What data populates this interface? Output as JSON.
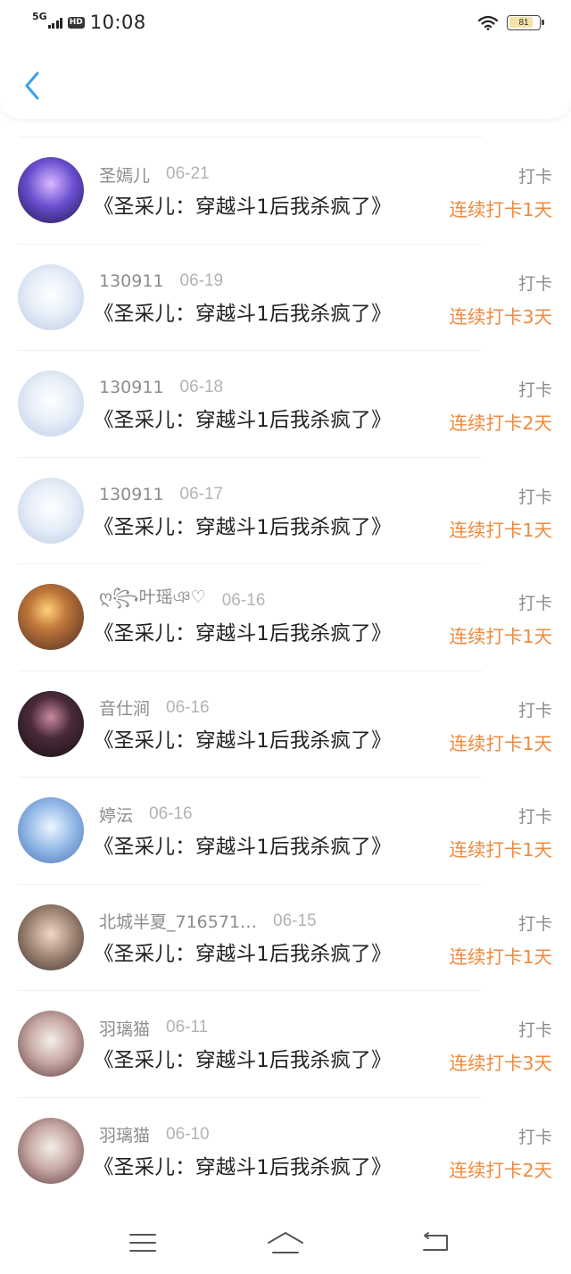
{
  "status_bar": {
    "network": "5G",
    "hd_badge": "HD",
    "time": "10:08",
    "battery_level": "81",
    "battery_fraction": 0.81
  },
  "header": {
    "back_icon": "chevron-left-icon",
    "accent_color": "#3aa0e8"
  },
  "colors": {
    "streak_orange": "#f08a3c",
    "name_gray": "#8c8c8c",
    "date_gray": "#b3b3b3"
  },
  "records": [
    {
      "name": "圣嫣儿",
      "date": "06-21",
      "book": "《圣采儿：穿越斗1后我杀疯了》",
      "type": "打卡",
      "streak": "连续打卡1天"
    },
    {
      "name": "130911",
      "date": "06-19",
      "book": "《圣采儿：穿越斗1后我杀疯了》",
      "type": "打卡",
      "streak": "连续打卡3天"
    },
    {
      "name": "130911",
      "date": "06-18",
      "book": "《圣采儿：穿越斗1后我杀疯了》",
      "type": "打卡",
      "streak": "连续打卡2天"
    },
    {
      "name": "130911",
      "date": "06-17",
      "book": "《圣采儿：穿越斗1后我杀疯了》",
      "type": "打卡",
      "streak": "连续打卡1天"
    },
    {
      "name": "ღ꧂叶瑶ঞ♡",
      "date": "06-16",
      "book": "《圣采儿：穿越斗1后我杀疯了》",
      "type": "打卡",
      "streak": "连续打卡1天"
    },
    {
      "name": "音仕涧",
      "date": "06-16",
      "book": "《圣采儿：穿越斗1后我杀疯了》",
      "type": "打卡",
      "streak": "连续打卡1天"
    },
    {
      "name": "婷沄",
      "date": "06-16",
      "book": "《圣采儿：穿越斗1后我杀疯了》",
      "type": "打卡",
      "streak": "连续打卡1天"
    },
    {
      "name": "北城半夏_716571…",
      "date": "06-15",
      "book": "《圣采儿：穿越斗1后我杀疯了》",
      "type": "打卡",
      "streak": "连续打卡1天"
    },
    {
      "name": "羽璃猫",
      "date": "06-11",
      "book": "《圣采儿：穿越斗1后我杀疯了》",
      "type": "打卡",
      "streak": "连续打卡3天"
    },
    {
      "name": "羽璃猫",
      "date": "06-10",
      "book": "《圣采儿：穿越斗1后我杀疯了》",
      "type": "打卡",
      "streak": "连续打卡2天"
    }
  ],
  "nav_bar": {
    "menu_icon": "menu-lines-icon",
    "home_icon": "home-icon",
    "back_icon": "return-icon"
  }
}
